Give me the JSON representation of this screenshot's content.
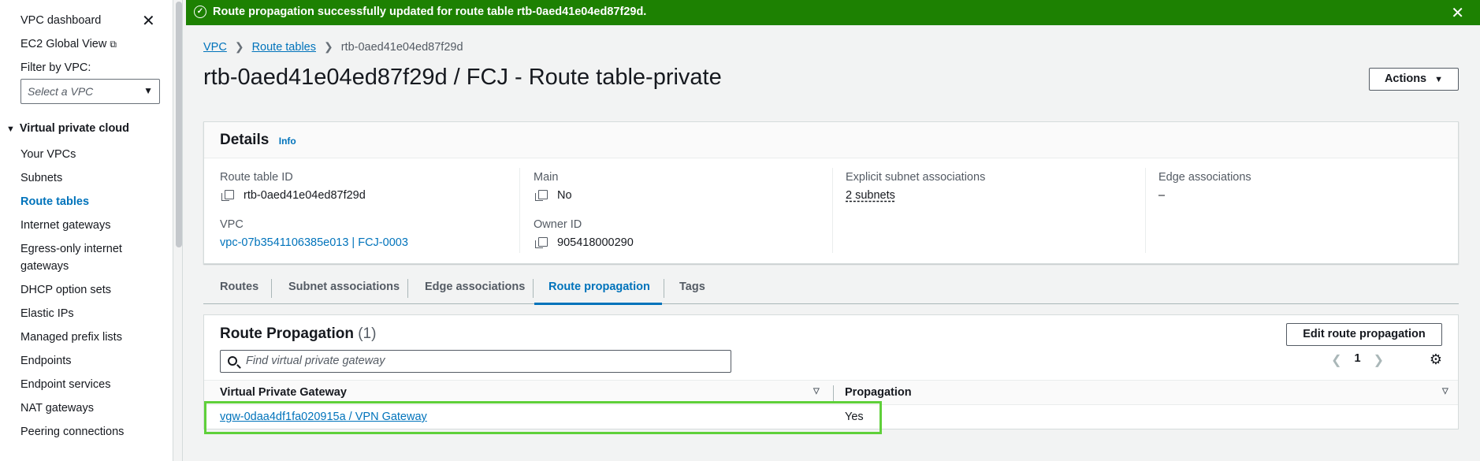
{
  "sidebar": {
    "dashboard": "VPC dashboard",
    "ec2_global_view": "EC2 Global View",
    "filter_label": "Filter by VPC:",
    "filter_placeholder": "Select a VPC",
    "section_title": "Virtual private cloud",
    "items": [
      {
        "label": "Your VPCs",
        "active": false
      },
      {
        "label": "Subnets",
        "active": false
      },
      {
        "label": "Route tables",
        "active": true
      },
      {
        "label": "Internet gateways",
        "active": false
      },
      {
        "label": "Egress-only internet gateways",
        "active": false
      },
      {
        "label": "DHCP option sets",
        "active": false
      },
      {
        "label": "Elastic IPs",
        "active": false
      },
      {
        "label": "Managed prefix lists",
        "active": false
      },
      {
        "label": "Endpoints",
        "active": false
      },
      {
        "label": "Endpoint services",
        "active": false
      },
      {
        "label": "NAT gateways",
        "active": false
      },
      {
        "label": "Peering connections",
        "active": false
      }
    ]
  },
  "flash": {
    "message": "Route propagation successfully updated for route table rtb-0aed41e04ed87f29d.",
    "color": "#1d8102"
  },
  "breadcrumb": {
    "vpc": "VPC",
    "route_tables": "Route tables",
    "current": "rtb-0aed41e04ed87f29d"
  },
  "page": {
    "title": "rtb-0aed41e04ed87f29d / FCJ - Route table-private",
    "actions_label": "Actions"
  },
  "details": {
    "title": "Details",
    "info": "Info",
    "route_table_id_label": "Route table ID",
    "route_table_id": "rtb-0aed41e04ed87f29d",
    "vpc_label": "VPC",
    "vpc_value": "vpc-07b3541106385e013 | FCJ-0003",
    "main_label": "Main",
    "main_value": "No",
    "owner_label": "Owner ID",
    "owner_value": "905418000290",
    "explicit_label": "Explicit subnet associations",
    "explicit_value": "2 subnets",
    "edge_label": "Edge associations",
    "edge_value": "–"
  },
  "tabs": {
    "routes": "Routes",
    "subnet_associations": "Subnet associations",
    "edge_associations": "Edge associations",
    "route_propagation": "Route propagation",
    "tags": "Tags",
    "active": "route_propagation"
  },
  "route_propagation": {
    "title": "Route Propagation",
    "count": "(1)",
    "edit_button": "Edit route propagation",
    "search_placeholder": "Find virtual private gateway",
    "page_number": "1",
    "columns": {
      "gateway": "Virtual Private Gateway",
      "propagation": "Propagation"
    },
    "rows": [
      {
        "gateway": "vgw-0daa4df1fa020915a / VPN Gateway",
        "propagation": "Yes"
      }
    ]
  }
}
